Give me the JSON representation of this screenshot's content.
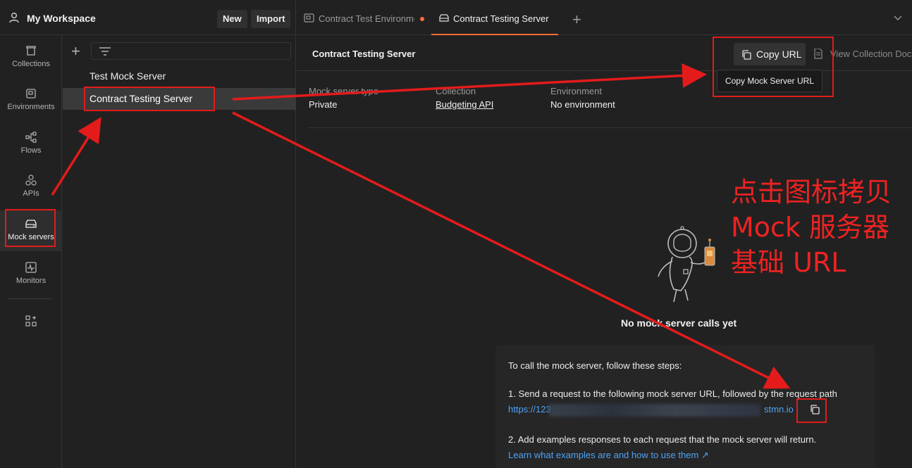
{
  "workspace": {
    "title": "My Workspace",
    "new_label": "New",
    "import_label": "Import"
  },
  "tabs": [
    {
      "label": "Contract Test Environment",
      "unsaved": true
    },
    {
      "label": "Contract Testing Server",
      "active": true
    }
  ],
  "rail": {
    "items": [
      {
        "label": "Collections",
        "icon": "collections-icon"
      },
      {
        "label": "Environments",
        "icon": "environments-icon"
      },
      {
        "label": "Flows",
        "icon": "flows-icon"
      },
      {
        "label": "APIs",
        "icon": "apis-icon"
      },
      {
        "label": "Mock servers",
        "icon": "mock-servers-icon",
        "active": true
      },
      {
        "label": "Monitors",
        "icon": "monitors-icon"
      }
    ]
  },
  "mock_list": {
    "items": [
      {
        "label": "Test Mock Server"
      },
      {
        "label": "Contract Testing Server",
        "selected": true
      }
    ]
  },
  "main": {
    "title": "Contract Testing Server",
    "copy_url_label": "Copy URL",
    "view_doc_label": "View Collection Docs",
    "tooltip": "Copy Mock Server URL",
    "meta": {
      "type_label": "Mock server type",
      "type_value": "Private",
      "collection_label": "Collection",
      "collection_value": "Budgeting API",
      "environment_label": "Environment",
      "environment_value": "No environment"
    },
    "empty_title": "No mock server calls yet",
    "steps": {
      "intro": "To call the mock server, follow these steps:",
      "step1": "1. Send a request to the following mock server URL, followed by the request path",
      "url_start": "https://123",
      "url_end": "stmn.io",
      "step2": "2. Add examples responses to each request that the mock server will return.",
      "learn_link": "Learn what examples are and how to use them ↗"
    }
  },
  "annotation": {
    "line1": "点击图标拷贝",
    "line2": "Mock 服务器",
    "line3": "基础 URL",
    "color": "#ee2222"
  },
  "colors": {
    "background": "#212121",
    "accent": "#ff6c37",
    "link": "#4ea3f5",
    "annotation": "#e31b1b"
  }
}
